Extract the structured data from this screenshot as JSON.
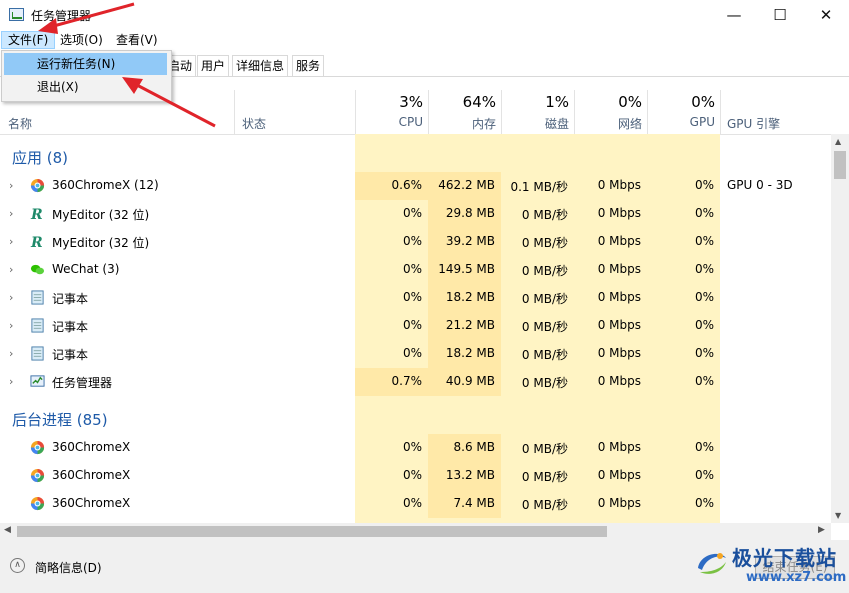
{
  "window": {
    "title": "任务管理器",
    "controls": {
      "minimize": "—",
      "maximize": "☐",
      "close": "✕"
    }
  },
  "menubar": {
    "items": [
      {
        "label": "文件(F)"
      },
      {
        "label": "选项(O)"
      },
      {
        "label": "查看(V)"
      }
    ]
  },
  "dropdown": {
    "items": [
      {
        "label": "运行新任务(N)"
      },
      {
        "label": "退出(X)"
      }
    ]
  },
  "tabs": [
    {
      "label": "启动"
    },
    {
      "label": "用户"
    },
    {
      "label": "详细信息"
    },
    {
      "label": "服务"
    }
  ],
  "columns": {
    "name": "名称",
    "status": "状态",
    "cpu": {
      "pct": "3%",
      "label": "CPU"
    },
    "memory": {
      "pct": "64%",
      "label": "内存"
    },
    "disk": {
      "pct": "1%",
      "label": "磁盘"
    },
    "network": {
      "pct": "0%",
      "label": "网络"
    },
    "gpu": {
      "pct": "0%",
      "label": "GPU"
    },
    "gpu_engine": "GPU 引擎"
  },
  "groups": {
    "apps": "应用 (8)",
    "background": "后台进程 (85)"
  },
  "apps": [
    {
      "name": "360ChromeX (12)",
      "icon": "chrome360",
      "cpu": "0.6%",
      "mem": "462.2 MB",
      "disk": "0.1 MB/秒",
      "net": "0 Mbps",
      "gpu": "0%",
      "gpu_engine": "GPU 0 - 3D",
      "hot": true
    },
    {
      "name": "MyEditor (32 位)",
      "icon": "myeditor",
      "cpu": "0%",
      "mem": "29.8 MB",
      "disk": "0 MB/秒",
      "net": "0 Mbps",
      "gpu": "0%",
      "gpu_engine": "",
      "hot": false
    },
    {
      "name": "MyEditor (32 位)",
      "icon": "myeditor",
      "cpu": "0%",
      "mem": "39.2 MB",
      "disk": "0 MB/秒",
      "net": "0 Mbps",
      "gpu": "0%",
      "gpu_engine": "",
      "hot": false
    },
    {
      "name": "WeChat (3)",
      "icon": "wechat",
      "cpu": "0%",
      "mem": "149.5 MB",
      "disk": "0 MB/秒",
      "net": "0 Mbps",
      "gpu": "0%",
      "gpu_engine": "",
      "hot": false
    },
    {
      "name": "记事本",
      "icon": "notepad",
      "cpu": "0%",
      "mem": "18.2 MB",
      "disk": "0 MB/秒",
      "net": "0 Mbps",
      "gpu": "0%",
      "gpu_engine": "",
      "hot": false
    },
    {
      "name": "记事本",
      "icon": "notepad",
      "cpu": "0%",
      "mem": "21.2 MB",
      "disk": "0 MB/秒",
      "net": "0 Mbps",
      "gpu": "0%",
      "gpu_engine": "",
      "hot": false
    },
    {
      "name": "记事本",
      "icon": "notepad",
      "cpu": "0%",
      "mem": "18.2 MB",
      "disk": "0 MB/秒",
      "net": "0 Mbps",
      "gpu": "0%",
      "gpu_engine": "",
      "hot": false
    },
    {
      "name": "任务管理器",
      "icon": "taskmgr",
      "cpu": "0.7%",
      "mem": "40.9 MB",
      "disk": "0 MB/秒",
      "net": "0 Mbps",
      "gpu": "0%",
      "gpu_engine": "",
      "hot": true
    }
  ],
  "background": [
    {
      "name": "360ChromeX",
      "icon": "chrome360",
      "cpu": "0%",
      "mem": "8.6 MB",
      "disk": "0 MB/秒",
      "net": "0 Mbps",
      "gpu": "0%"
    },
    {
      "name": "360ChromeX",
      "icon": "chrome360",
      "cpu": "0%",
      "mem": "13.2 MB",
      "disk": "0 MB/秒",
      "net": "0 Mbps",
      "gpu": "0%"
    },
    {
      "name": "360ChromeX",
      "icon": "chrome360",
      "cpu": "0%",
      "mem": "7.4 MB",
      "disk": "0 MB/秒",
      "net": "0 Mbps",
      "gpu": "0%"
    }
  ],
  "footer": {
    "fewer_details": "简略信息(D)",
    "end_task": "结束任务(E)"
  },
  "watermark": {
    "text": "极光下载站",
    "url": "www.xz7.com"
  },
  "colors": {
    "heat_light": "#fff4c4",
    "heat_medium": "#ffe9a8",
    "group_title": "#1e5aa8",
    "menu_highlight": "#91c9f7",
    "annotation_arrow": "#e0242a"
  }
}
